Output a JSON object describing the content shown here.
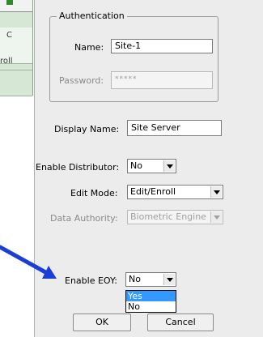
{
  "background_window": {
    "cells": [
      "C",
      "roll",
      ""
    ]
  },
  "dialog": {
    "authentication": {
      "legend": "Authentication",
      "name_label": "Name:",
      "name_value": "Site-1",
      "password_label": "Password:",
      "password_value": "*****"
    },
    "display_name_label": "Display Name:",
    "display_name_value": "Site Server",
    "enable_distributor_label": "Enable Distributor:",
    "enable_distributor_value": "No",
    "edit_mode_label": "Edit Mode:",
    "edit_mode_value": "Edit/Enroll",
    "data_authority_label": "Data Authority:",
    "data_authority_value": "Biometric Engine",
    "enable_eoy_label": "Enable EOY:",
    "enable_eoy_value": "No",
    "enable_eoy_options": [
      "Yes",
      "No"
    ],
    "enable_eoy_highlighted": "Yes",
    "ok_label": "OK",
    "cancel_label": "Cancel"
  },
  "colors": {
    "arrow": "#1a3fd6",
    "highlight": "#3399ff",
    "dialog_bg": "#ececec"
  }
}
